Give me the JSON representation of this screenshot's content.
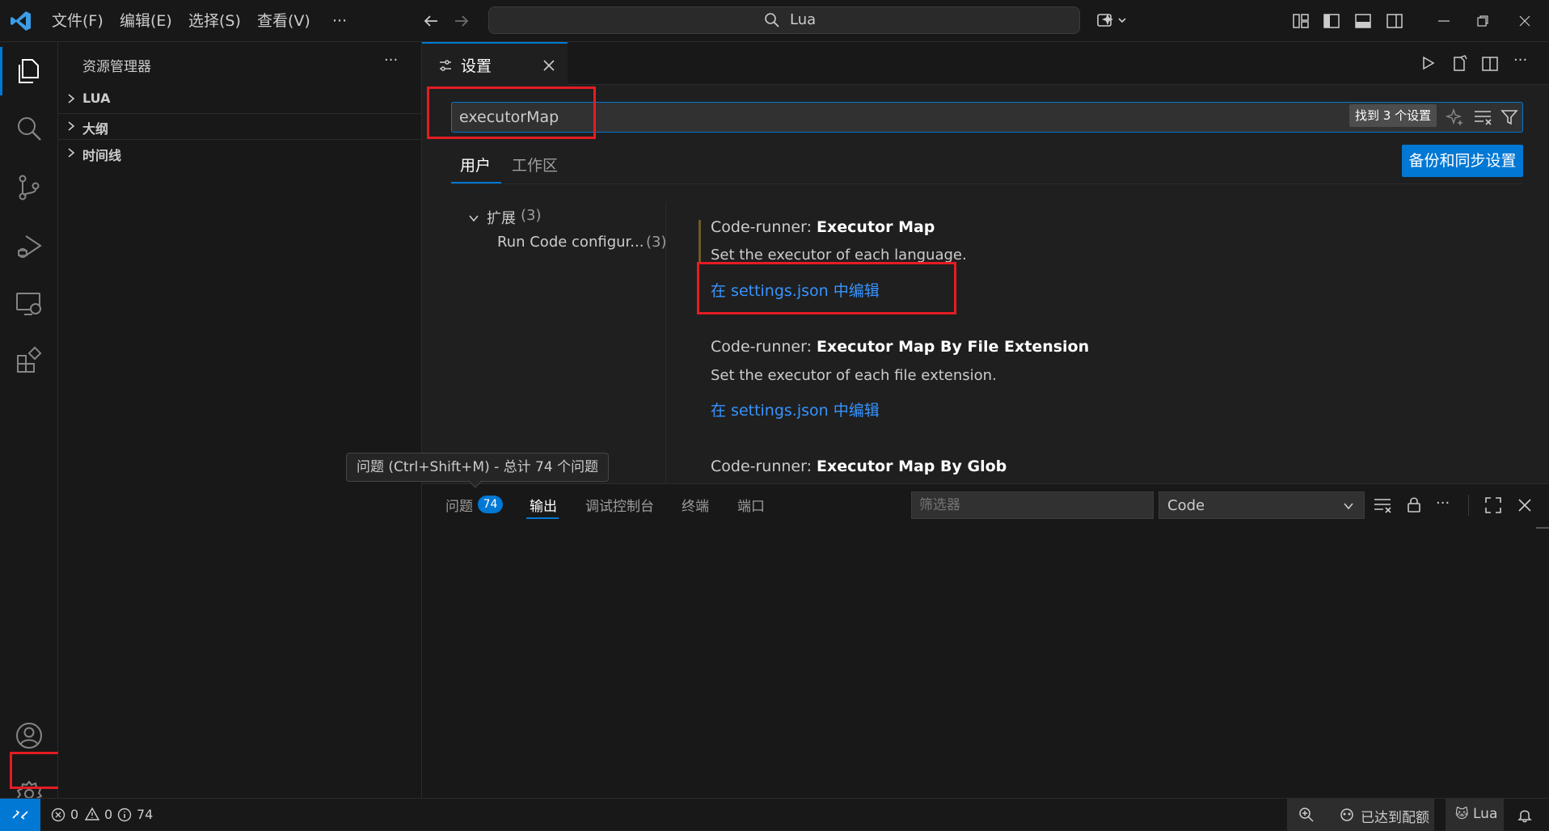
{
  "titlebar": {
    "menus": [
      "文件(F)",
      "编辑(E)",
      "选择(S)",
      "查看(V)"
    ],
    "more": "···",
    "search_text": "Lua"
  },
  "sidebar": {
    "title": "资源管理器",
    "more": "···",
    "sections": [
      {
        "label": "LUA"
      },
      {
        "label": "大纲"
      },
      {
        "label": "时间线"
      }
    ]
  },
  "editor": {
    "tab_label": "设置",
    "search_value": "executorMap",
    "found_count": "找到 3 个设置",
    "scope_tabs": [
      "用户",
      "工作区"
    ],
    "sync_button": "备份和同步设置",
    "toc": {
      "group_label": "扩展",
      "group_count": "(3)",
      "item_label": "Run Code configur...",
      "item_count": "(3)"
    },
    "settings": [
      {
        "prefix": "Code-runner: ",
        "name": "Executor Map",
        "description": "Set the executor of each language.",
        "link": "在 settings.json 中编辑"
      },
      {
        "prefix": "Code-runner: ",
        "name": "Executor Map By File Extension",
        "description": "Set the executor of each file extension.",
        "link": "在 settings.json 中编辑"
      },
      {
        "prefix": "Code-runner: ",
        "name": "Executor Map By Glob",
        "description": "",
        "link": ""
      }
    ]
  },
  "tooltip": "问题 (Ctrl+Shift+M) - 总计 74 个问题",
  "panel": {
    "tabs": [
      "问题",
      "输出",
      "调试控制台",
      "终端",
      "端口"
    ],
    "problems_count": "74",
    "filter_placeholder": "筛选器",
    "output_channel": "Code"
  },
  "statusbar": {
    "errors": "0",
    "warnings": "0",
    "infos": "74",
    "quota": "已达到配额",
    "language": "Lua"
  },
  "colors": {
    "accent": "#0078d4",
    "highlight_box": "#e51c23",
    "link": "#3794ff"
  }
}
